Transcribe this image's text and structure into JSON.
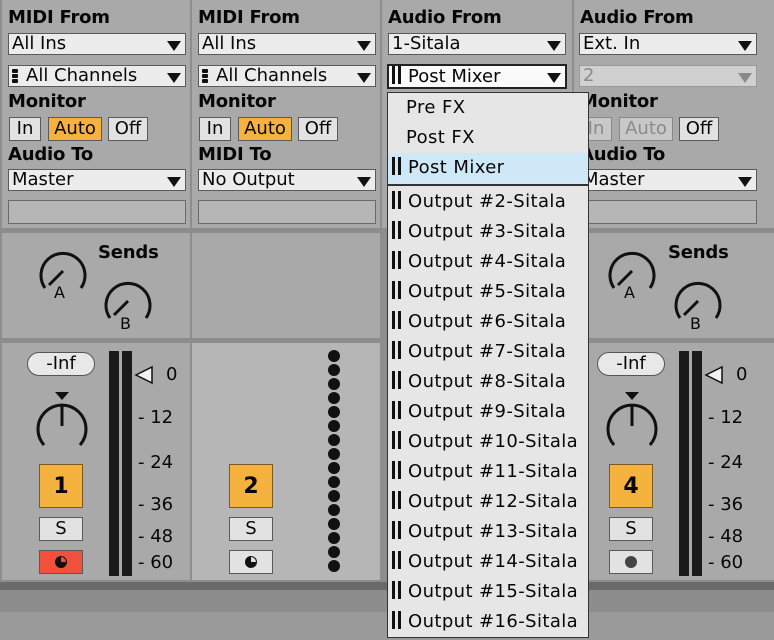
{
  "tracks": [
    {
      "input_label": "MIDI From",
      "input_value": "All Ins",
      "channel_value": "All Channels",
      "monitor_label": "Monitor",
      "monitor_in": "In",
      "monitor_auto": "Auto",
      "monitor_off": "Off",
      "output_label": "Audio To",
      "output_value": "Master",
      "sends_label": "Sends",
      "send_a": "A",
      "send_b": "B",
      "volume": "-Inf",
      "number": "1",
      "solo": "S",
      "meter_ticks": [
        "0",
        "12",
        "24",
        "36",
        "48",
        "60"
      ]
    },
    {
      "input_label": "MIDI From",
      "input_value": "All Ins",
      "channel_value": "All Channels",
      "monitor_label": "Monitor",
      "monitor_in": "In",
      "monitor_auto": "Auto",
      "monitor_off": "Off",
      "output_label": "MIDI To",
      "output_value": "No Output",
      "number": "2",
      "solo": "S"
    },
    {
      "input_label": "Audio From",
      "input_value": "1-Sitala",
      "channel_value": "Post Mixer"
    },
    {
      "input_label": "Audio From",
      "input_value": "Ext. In",
      "channel_value": "2",
      "monitor_label": "Monitor",
      "monitor_in": "In",
      "monitor_auto": "Auto",
      "monitor_off": "Off",
      "output_label": "Audio To",
      "output_value": "Master",
      "sends_label": "Sends",
      "send_a": "A",
      "send_b": "B",
      "volume": "-Inf",
      "number": "4",
      "solo": "S",
      "meter_ticks": [
        "0",
        "12",
        "24",
        "36",
        "48",
        "60"
      ]
    }
  ],
  "menu": {
    "top_items": [
      "Pre FX",
      "Post FX",
      "Post Mixer"
    ],
    "selected": "Post Mixer",
    "outputs": [
      "Output #2-Sitala",
      "Output #3-Sitala",
      "Output #4-Sitala",
      "Output #5-Sitala",
      "Output #6-Sitala",
      "Output #7-Sitala",
      "Output #8-Sitala",
      "Output #9-Sitala",
      "Output #10-Sitala",
      "Output #11-Sitala",
      "Output #12-Sitala",
      "Output #13-Sitala",
      "Output #14-Sitala",
      "Output #15-Sitala",
      "Output #16-Sitala"
    ]
  },
  "colors": {
    "accent": "#f6b23e",
    "arm_red": "#f0503c",
    "selection": "#cfe8f8",
    "panel": "#a9a9a9"
  },
  "icons": [
    "chevron-down-icon",
    "channel-selector-icon",
    "output-channel-icon",
    "send-knob-icon",
    "pan-knob-icon",
    "record-arm-icon",
    "peak-triangle-icon"
  ]
}
